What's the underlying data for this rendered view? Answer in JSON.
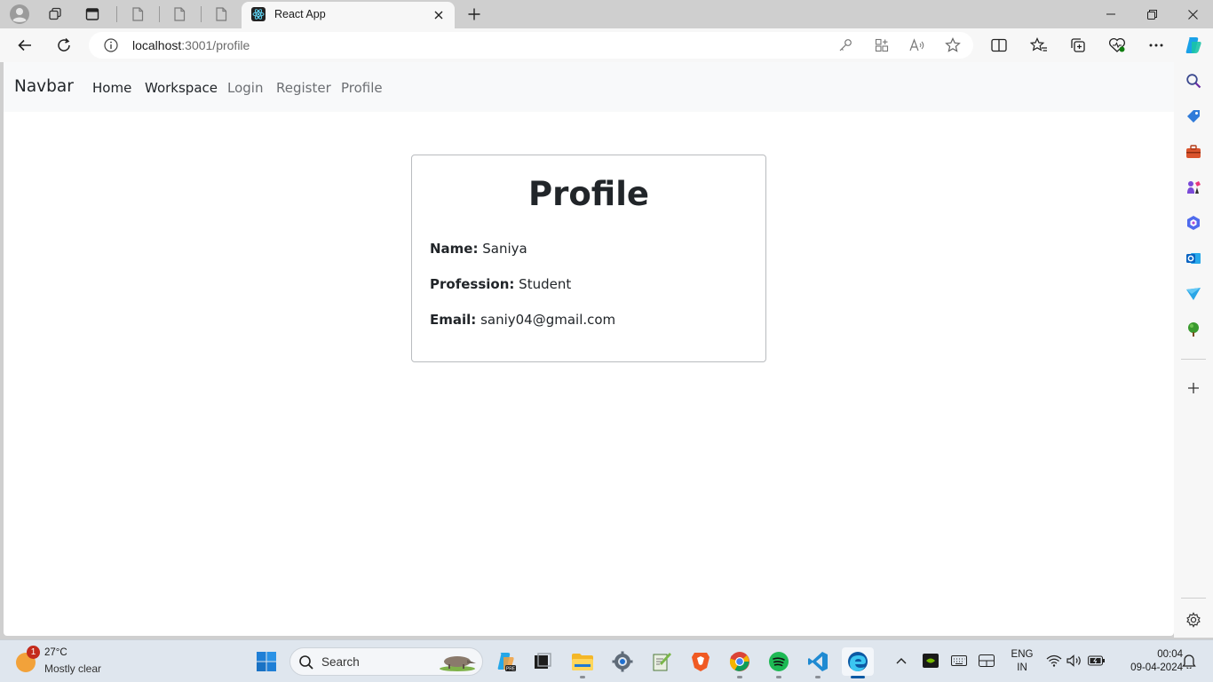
{
  "browser": {
    "tab_title": "React App",
    "url_host": "localhost",
    "url_rest": ":3001/profile"
  },
  "page": {
    "brand": "Navbar",
    "nav": [
      {
        "label": "Home",
        "style": "dark"
      },
      {
        "label": "Workspace",
        "style": "dark"
      },
      {
        "label": "Login",
        "style": "muted"
      },
      {
        "label": "Register",
        "style": "muted"
      },
      {
        "label": "Profile",
        "style": "muted"
      }
    ],
    "profile": {
      "title": "Profile",
      "name_label": "Name:",
      "name": "Saniya",
      "profession_label": "Profession:",
      "profession": "Student",
      "email_label": "Email:",
      "email": "saniy04@gmail.com"
    }
  },
  "taskbar": {
    "weather": {
      "temp": "27°C",
      "condition": "Mostly clear",
      "badge": "1"
    },
    "search_label": "Search",
    "lang_line1": "ENG",
    "lang_line2": "IN",
    "time": "00:04",
    "date": "09-04-2024"
  },
  "colors": {
    "brand_text": "#212529",
    "muted_link": "#6c6f73",
    "edge_accent": "#0c59a4"
  }
}
